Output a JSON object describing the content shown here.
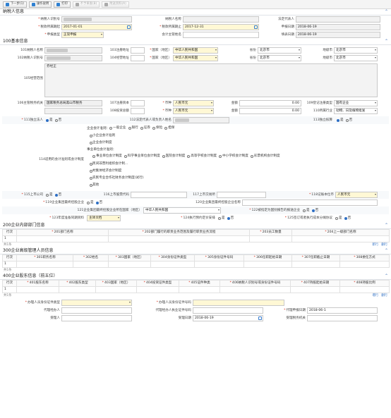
{
  "toolbar": {
    "buttons": [
      {
        "label": "下一步(1)",
        "color": "#2f80d1",
        "disabled": false,
        "icon": "next-icon"
      },
      {
        "label": "操作说明",
        "color": "#2f80d1",
        "disabled": false,
        "icon": "help-icon"
      },
      {
        "label": "打印",
        "color": "#2f80d1",
        "disabled": false,
        "icon": "print-icon"
      },
      {
        "label": "不予审查(B)",
        "color": "#aaa",
        "disabled": true,
        "icon": "stop-icon"
      },
      {
        "label": "附送资料(A)",
        "color": "#aaa",
        "disabled": true,
        "icon": "attach-icon"
      }
    ]
  },
  "taxpayer": {
    "title": "纳税人信息",
    "id_label": "纳税人识别号",
    "name_label": "纳税人名称",
    "legal_rep_label": "法定代表人",
    "period_start_label": "税款所属期起",
    "period_start": "2017-01-01",
    "period_end_label": "税款所属期止",
    "period_end": "2017-12-31",
    "report_date_label": "申报日期",
    "report_date": "2018-06-19",
    "decl_type_label": "申报类型",
    "decl_type": "正常申报",
    "accountant_label": "会计主管姓名",
    "fill_date_label": "填表日期",
    "fill_date": "2018-06-19"
  },
  "basic": {
    "title": "100基本信息",
    "f101": "101纳税人名称",
    "f102": "102纳税人识别号",
    "f103": "103注册地址",
    "f104": "104经营地址",
    "country_label": "国家（地区）",
    "country": "中华人民共和国",
    "country2": "中华人民共和国",
    "prov_label": "省份",
    "prov": "北京市",
    "prov2": "北京市",
    "city_label": "地级市",
    "city": "北京市",
    "city2": "北京市",
    "f105": "105经营范围",
    "scope_first": "券经正",
    "f106": "106主管税务机关",
    "tax_office": "国家税务总局黑山市税务",
    "f107": "107注册资本",
    "f108": "108投资总额",
    "currency_label": "币种",
    "currency": "人民币元",
    "currency2": "人民币元",
    "amount_label": "金额",
    "amount1": "0.00",
    "amount2": "0.00",
    "f109": "109登记注册类型",
    "reg_type": "国有企业",
    "f110": "110所属行业",
    "industry": "动物、日及植物批发",
    "f111": "111独立法人",
    "yes": "是",
    "no": "否",
    "f112": "112法定代表人或负责人姓名",
    "f113": "113独立核算",
    "f114": "114适用的会计准则或会计制度",
    "acct_label": "企业会计准则：",
    "acct_opts": [
      "一般企业",
      "银行",
      "证券",
      "保险",
      "担保"
    ],
    "acct_small": "小企业会计准则",
    "acct_sys": "企业会计制度",
    "inst_label": "事业单位会计准则：",
    "inst_opts": [
      "事业单位会计制度",
      "科学事业单位会计制度",
      "医院会计制度",
      "高等学校会计制度",
      "中小学校会计制度",
      "彩票机构会计制度"
    ],
    "other_opts": [
      "民间非营利组织会计制...",
      "村集体经济会计制度",
      "农民专业合作社财务会计制度(试行)",
      "其他"
    ],
    "f115": "115上市公司",
    "f116": "116上市股票代码",
    "f117": "117上市交易所",
    "f118": "118记账本位币",
    "book_currency": "人民币元",
    "f119": "119企业集团最终控股企业",
    "f120": "120企业集团最终控股企业名称",
    "f121": "121企业集团最终控股企业所在国家（地区）",
    "ctrl_country": "中华人民共和国",
    "f122": "122被指定为国别报告的报送企业",
    "f123": "123年度准备同期资料",
    "f123v": "主体文档",
    "f124": "124执行预约定价安排",
    "f125": "125签订或者执行成本分摊协议"
  },
  "s200": {
    "title": "200企业内部部门信息",
    "cols": [
      "行次",
      "201部门名称",
      "202部门履行的职责业务范围及履行职责业务流程",
      "203员工数量",
      "204上一级部门名称"
    ],
    "row": "1",
    "count": "共1条",
    "prev": "新行",
    "next": "删行"
  },
  "s300": {
    "title": "300企业高级管理人员信息",
    "cols": [
      "行次",
      "301职务名称",
      "302姓名",
      "303国家（地区）",
      "304身份证件类型",
      "305身份证件号码",
      "306任职起始日期",
      "307任职截止日期",
      "308委任方式"
    ],
    "row": "1",
    "count": "共1条"
  },
  "s400": {
    "title": "400企业股东信息（前五位）",
    "cols": [
      "行次",
      "401股东名称",
      "402股东类型",
      "403国家（地区）",
      "404投资证件类型",
      "405证件种类",
      "406纳税人识别号或身份证件号码",
      "407持股起始日期",
      "408持股比例"
    ],
    "row": "1",
    "count": "共1条",
    "prev": "增行",
    "next": "删行"
  },
  "footer": {
    "id_type": "办理人员身份证件类型",
    "id_no": "办理人员身份证件号码",
    "agent": "代理经办人",
    "agent_cert": "代理经办人执业证件号码",
    "agent_date": "代理申报日期",
    "agent_date_v": "2018-06-1",
    "recv": "受理人",
    "recv_date": "受理日期",
    "recv_date_v": "2018-06-19",
    "recv_office": "受理税务机关"
  }
}
